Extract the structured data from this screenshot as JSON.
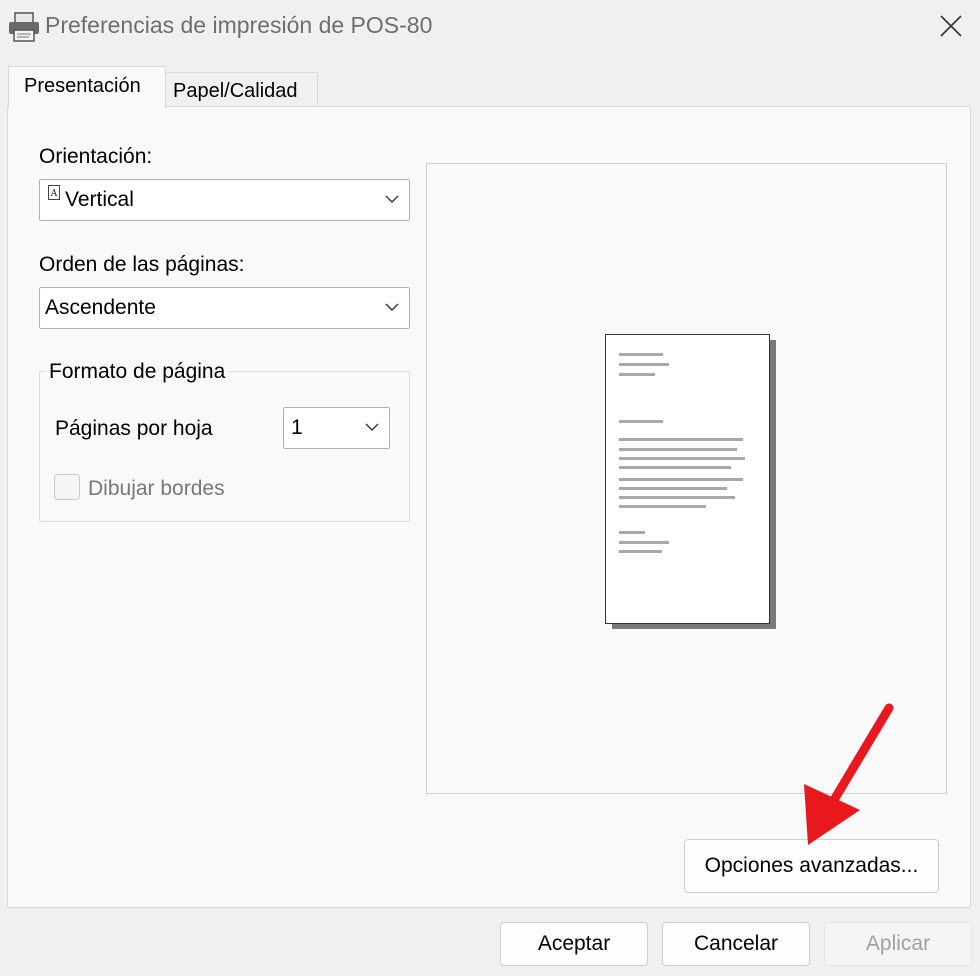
{
  "window": {
    "title": "Preferencias de impresión de POS-80",
    "app_icon": "printer-icon",
    "close_icon": "close-icon"
  },
  "tabs": [
    {
      "label": "Presentación",
      "active": true
    },
    {
      "label": "Papel/Calidad",
      "active": false
    }
  ],
  "layout_tab": {
    "orientation": {
      "label": "Orientación:",
      "value": "Vertical",
      "icon": "portrait-page-icon"
    },
    "page_order": {
      "label": "Orden de las páginas:",
      "value": "Ascendente"
    },
    "page_format": {
      "legend": "Formato de página",
      "pages_per_sheet": {
        "label": "Páginas por hoja",
        "value": "1"
      },
      "draw_borders": {
        "label": "Dibujar bordes",
        "checked": false,
        "enabled": false
      }
    },
    "advanced_button": "Opciones avanzadas..."
  },
  "footer": {
    "ok": "Aceptar",
    "cancel": "Cancelar",
    "apply": "Aplicar"
  },
  "colors": {
    "annotation_arrow": "#e8191c",
    "window_bg": "#f0f0f0",
    "panel_bg": "#f9f9f9"
  }
}
